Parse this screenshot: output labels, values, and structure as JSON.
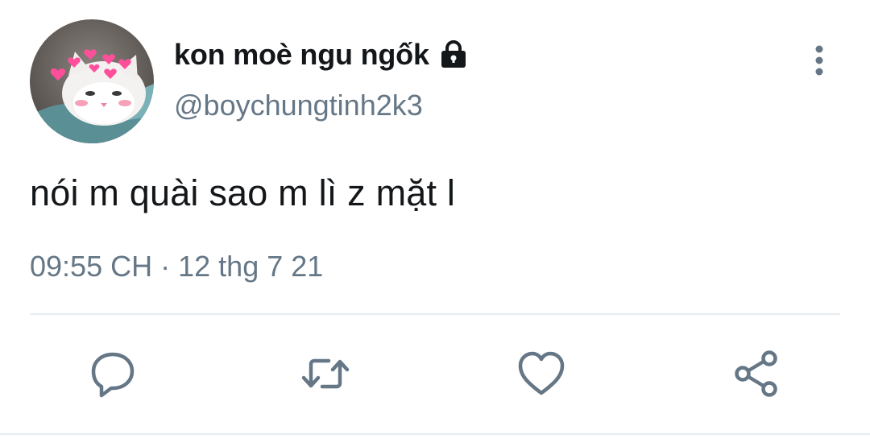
{
  "user": {
    "display_name": "kon moè ngu ngốk",
    "handle": "@boychungtinh2k3",
    "protected_icon": "lock-icon",
    "avatar_icon": "cat-avatar"
  },
  "tweet": {
    "text": "nói m quài sao m lì z mặt l",
    "time": "09:55 CH",
    "separator": "·",
    "date": "12 thg 7 21"
  },
  "actions": [
    {
      "name": "reply",
      "icon": "reply-icon"
    },
    {
      "name": "retweet",
      "icon": "retweet-icon"
    },
    {
      "name": "like",
      "icon": "heart-icon"
    },
    {
      "name": "share",
      "icon": "share-icon"
    }
  ],
  "menu_icon": "more-vertical-icon",
  "colors": {
    "text_primary": "#14171a",
    "text_secondary": "#657786",
    "icon": "#657786",
    "divider": "#e6ecf0",
    "background": "#ffffff"
  }
}
